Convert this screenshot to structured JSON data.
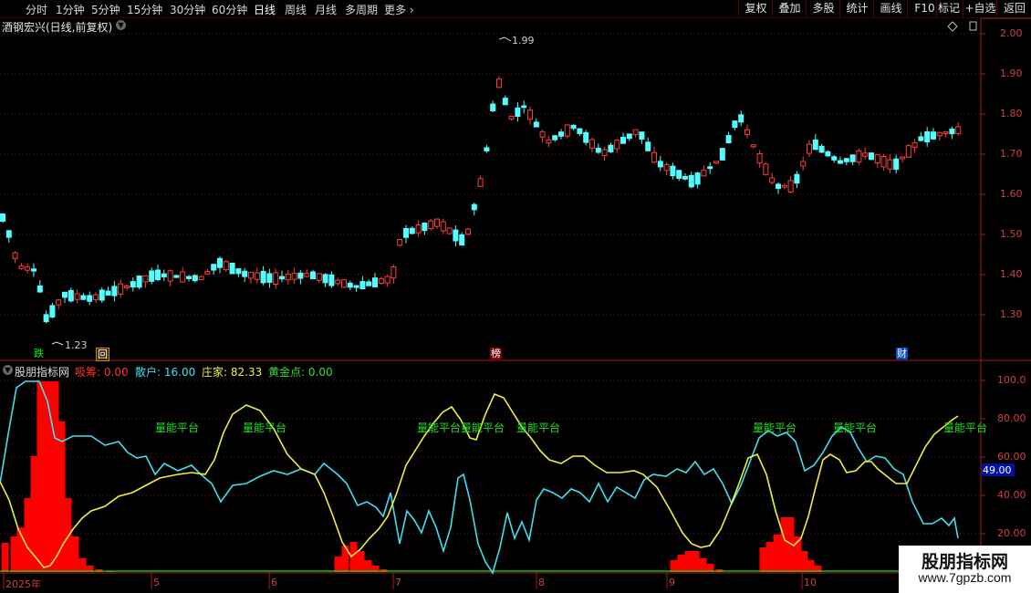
{
  "toolbar": {
    "timeframes": [
      "分时",
      "1分钟",
      "5分钟",
      "15分钟",
      "30分钟",
      "60分钟",
      "日线",
      "周线",
      "月线",
      "多周期",
      "更多"
    ],
    "active": "日线",
    "right_buttons": [
      "复权",
      "叠加",
      "多股",
      "统计",
      "画线",
      "F10",
      "标记",
      "+自选",
      "返回"
    ]
  },
  "main": {
    "title": "酒钢宏兴(日线,前复权)",
    "price_labels": [
      "2.00",
      "1.90",
      "1.80",
      "1.70",
      "1.60",
      "1.50",
      "1.40",
      "1.30"
    ],
    "high_label": "1.99",
    "low_label": "1.23",
    "events": [
      "跌",
      "回",
      "榜",
      "财"
    ]
  },
  "indicator": {
    "name": "股朋指标网",
    "values": [
      {
        "label": "吸筹",
        "value": "0.00",
        "color": "#ff3030"
      },
      {
        "label": "散户",
        "value": "16.00",
        "color": "#40e0f0"
      },
      {
        "label": "庄家",
        "value": "82.33",
        "color": "#f0f040"
      },
      {
        "label": "黄金点",
        "value": "0.00",
        "color": "#30e030"
      }
    ],
    "axis_labels": [
      "100.0",
      "80.00",
      "60.00",
      "40.00",
      "20.00"
    ],
    "current_value": "49.00",
    "pattern_label": "量能平台"
  },
  "dates": [
    "2025年",
    "5",
    "6",
    "7",
    "8",
    "9",
    "10"
  ],
  "watermark": {
    "title": "股朋指标网",
    "url": "www.7gpzb.com"
  }
}
